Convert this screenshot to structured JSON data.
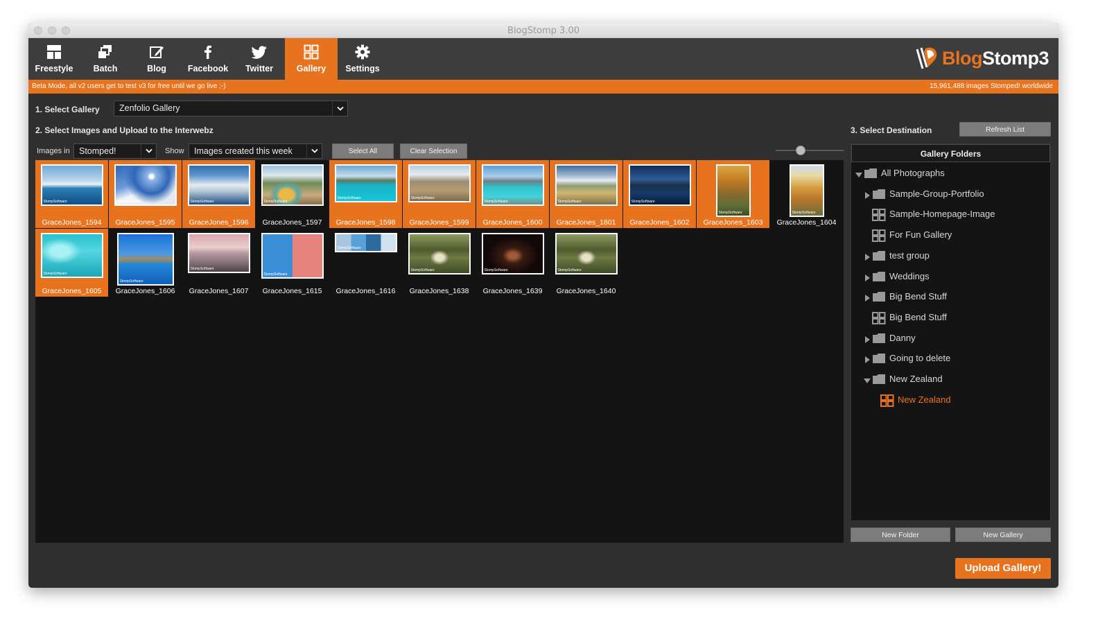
{
  "window": {
    "title": "BlogStomp 3.00"
  },
  "toolbar": {
    "items": [
      {
        "label": "Freestyle",
        "icon": "freestyle-icon"
      },
      {
        "label": "Batch",
        "icon": "batch-icon"
      },
      {
        "label": "Blog",
        "icon": "blog-edit-icon"
      },
      {
        "label": "Facebook",
        "icon": "facebook-icon"
      },
      {
        "label": "Twitter",
        "icon": "twitter-icon"
      },
      {
        "label": "Gallery",
        "icon": "gallery-grid-icon",
        "active": true
      },
      {
        "label": "Settings",
        "icon": "gear-icon"
      }
    ]
  },
  "logo": {
    "text_a": "Blog",
    "text_b": "Stomp3"
  },
  "beta": {
    "message": "Beta Mode, all v2 users get to test v3 for free until we go live ;-)",
    "counter": "15,961,488 images Stomped! worldwide"
  },
  "step1": {
    "label": "1. Select Gallery",
    "value": "Zenfolio Gallery"
  },
  "step2": {
    "label": "2. Select Images and Upload to the Interwebz",
    "images_in_label": "Images in",
    "images_in_value": "Stomped!",
    "show_label": "Show",
    "show_value": "Images created this week",
    "select_all": "Select All",
    "clear_selection": "Clear Selection",
    "thumb_size": 0.35
  },
  "images": [
    {
      "name": "GraceJones_1594",
      "selected": true,
      "scene": "lake"
    },
    {
      "name": "GraceJones_1595",
      "selected": true,
      "scene": "snow"
    },
    {
      "name": "GraceJones_1596",
      "selected": true,
      "scene": "clouds"
    },
    {
      "name": "GraceJones_1597",
      "selected": false,
      "scene": "pool"
    },
    {
      "name": "GraceJones_1598",
      "selected": true,
      "scene": "turquoise"
    },
    {
      "name": "GraceJones_1599",
      "selected": true,
      "scene": "grass"
    },
    {
      "name": "GraceJones_1600",
      "selected": true,
      "scene": "lake2"
    },
    {
      "name": "GraceJones_1801",
      "selected": true,
      "scene": "road"
    },
    {
      "name": "GraceJones_1602",
      "selected": true,
      "scene": "dark"
    },
    {
      "name": "GraceJones_1603",
      "selected": true,
      "scene": "autumn"
    },
    {
      "name": "GraceJones_1604",
      "selected": false,
      "scene": "trees"
    },
    {
      "name": "GraceJones_1605",
      "selected": true,
      "scene": "water"
    },
    {
      "name": "GraceJones_1606",
      "selected": false,
      "scene": "bluelake"
    },
    {
      "name": "GraceJones_1607",
      "selected": false,
      "scene": "pinkjetty"
    },
    {
      "name": "GraceJones_1615",
      "selected": false,
      "scene": "split"
    },
    {
      "name": "GraceJones_1616",
      "selected": false,
      "scene": "strip"
    },
    {
      "name": "GraceJones_1638",
      "selected": false,
      "scene": "forest"
    },
    {
      "name": "GraceJones_1639",
      "selected": false,
      "scene": "night"
    },
    {
      "name": "GraceJones_1640",
      "selected": false,
      "scene": "forest"
    }
  ],
  "watermark": "StompSoftware",
  "step3": {
    "label": "3. Select Destination",
    "refresh": "Refresh List",
    "tree_title": "Gallery Folders",
    "nodes": [
      {
        "label": "All Photographs",
        "type": "folder",
        "arrow": "down",
        "level": 0
      },
      {
        "label": "Sample-Group-Portfolio",
        "type": "folder",
        "arrow": "right",
        "level": 1
      },
      {
        "label": "Sample-Homepage-Image",
        "type": "gallery",
        "arrow": "",
        "level": 1
      },
      {
        "label": "For Fun Gallery",
        "type": "gallery",
        "arrow": "",
        "level": 1
      },
      {
        "label": "test group",
        "type": "folder",
        "arrow": "right",
        "level": 1
      },
      {
        "label": "Weddings",
        "type": "folder",
        "arrow": "right",
        "level": 1
      },
      {
        "label": "Big Bend Stuff",
        "type": "folder",
        "arrow": "right",
        "level": 1
      },
      {
        "label": "Big Bend Stuff",
        "type": "gallery",
        "arrow": "",
        "level": 1
      },
      {
        "label": "Danny",
        "type": "folder",
        "arrow": "right",
        "level": 1
      },
      {
        "label": "Going to delete",
        "type": "folder",
        "arrow": "right",
        "level": 1
      },
      {
        "label": "New Zealand",
        "type": "folder",
        "arrow": "down",
        "level": 1
      },
      {
        "label": "New Zealand",
        "type": "gallery",
        "arrow": "",
        "level": 2,
        "active": true
      }
    ],
    "new_folder": "New Folder",
    "new_gallery": "New Gallery",
    "upload": "Upload Gallery!"
  },
  "colors": {
    "accent": "#e8731f",
    "bg": "#2f2f2f",
    "panel": "#141414"
  }
}
